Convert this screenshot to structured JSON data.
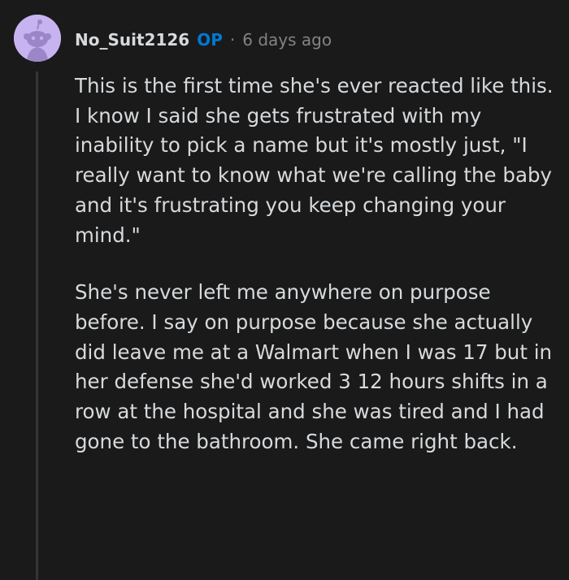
{
  "comment": {
    "avatar_icon": "reddit-snoo-icon",
    "avatar_color": "#c8b3f1",
    "username": "No_Suit2126",
    "op_badge": "OP",
    "separator": "·",
    "timestamp": "6 days ago",
    "paragraphs": [
      "This is the first time she's ever reacted like this. I know I said she gets frustrated with my inability to pick a name but it's mostly just, \"I really want to know what we're calling the baby and it's frustrating you keep changing your mind.\"",
      "She's never left me anywhere on purpose before. I say on purpose because she actually did leave me at a Walmart when I was 17 but in her defense she'd worked 3 12 hours shifts in a row at the hospital and she was tired and I had gone to the bathroom. She came right back."
    ]
  },
  "colors": {
    "background": "#1a1a1b",
    "text": "#d7dadc",
    "meta": "#818384",
    "op": "#0079d3",
    "thread_line": "#343536"
  }
}
